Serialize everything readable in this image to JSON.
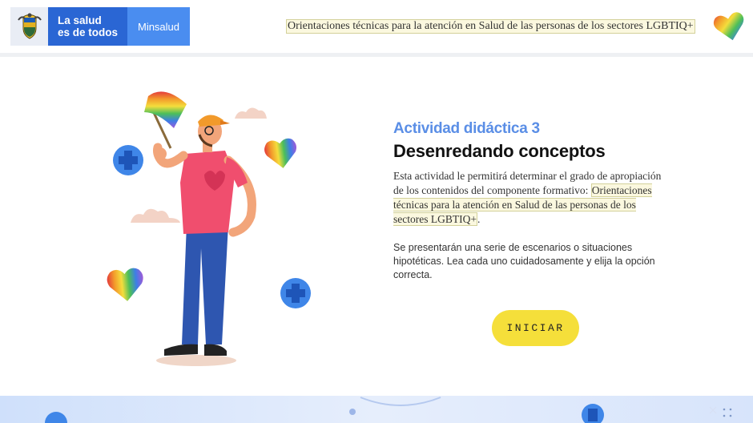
{
  "header": {
    "brand_line1": "La salud",
    "brand_line2": "es de todos",
    "brand_ministry": "Minsalud",
    "title": "Orientaciones técnicas para la atención en Salud de las personas de los sectores LGBTIQ+"
  },
  "activity": {
    "number_label": "Actividad didáctica 3",
    "title": "Desenredando conceptos",
    "description_intro": "Esta actividad le permitirá determinar el grado de apropiación de los contenidos del componente formativo:",
    "description_highlight": "Orientaciones técnicas para la atención en Salud de las personas de los sectores LGBTIQ+",
    "description_end": ".",
    "instructions": "Se presentarán una serie de escenarios o situaciones hipotéticas. Lea cada uno cuidadosamente y elija la opción correcta.",
    "start_label": "INICIAR"
  },
  "colors": {
    "brand_blue": "#2a66d4",
    "ministry_blue": "#4a8df0",
    "activity_blue": "#5a8ee6",
    "button_yellow": "#f5df3a",
    "highlight_bg": "#fbf8df"
  },
  "icons": [
    "colombia-shield-icon",
    "rainbow-heart-icon",
    "rainbow-flag-icon",
    "blue-cross-icon",
    "cloud-icon"
  ]
}
